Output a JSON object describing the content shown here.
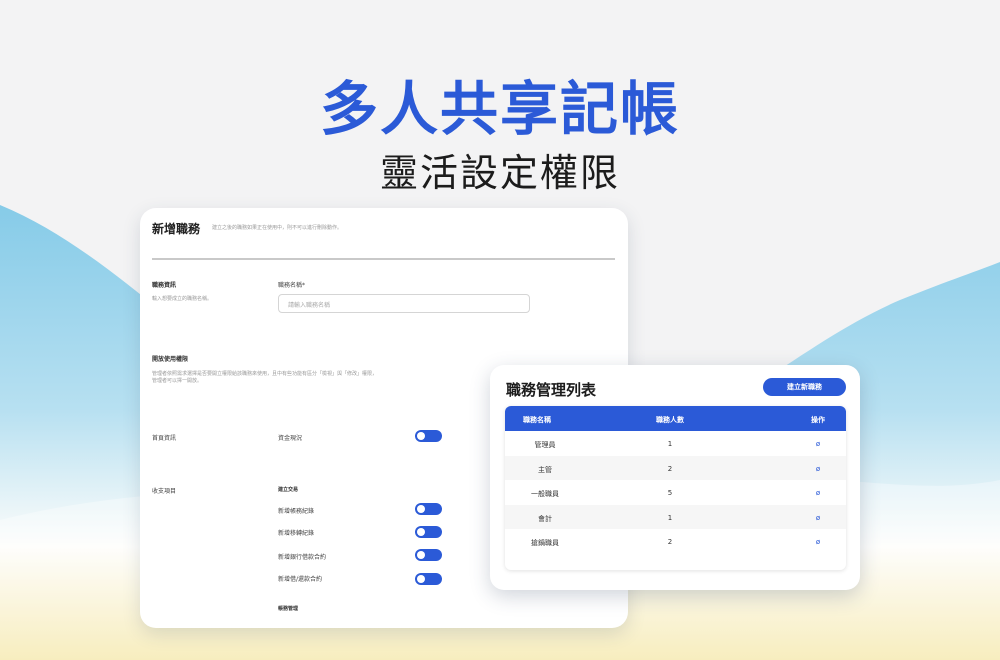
{
  "headline": "多人共享記帳",
  "subline": "靈活設定權限",
  "form": {
    "title": "新增職務",
    "title_hint": "建立之後的職務如果正在使用中，則不可以進行刪除動作。",
    "section_info": "職務資訊",
    "section_info_hint": "輸入想要成立的職務名稱。",
    "name_label": "職務名稱*",
    "name_placeholder": "請輸入職務名稱",
    "section_perm": "開放使用權限",
    "section_perm_hint_1": "管理者依照需求選擇是否要開立權限給該職務來使用，且中有些功能有區分「檢視」與「修改」權限，",
    "section_perm_hint_2": "管理者可以擇一開放。",
    "home_label": "首頁資訊",
    "home_item": "資金現況",
    "income_label": "收支項目",
    "create_group": "建立交易",
    "items": [
      "新增帳務紀錄",
      "新增移轉紀錄",
      "新增銀行借款合約",
      "新增借/還款合約"
    ],
    "manage_group": "帳務管理"
  },
  "list": {
    "title": "職務管理列表",
    "create_button": "建立新職務",
    "columns": [
      "職務名稱",
      "職務人數",
      "操作"
    ],
    "rows": [
      {
        "name": "管理員",
        "count": "1"
      },
      {
        "name": "主管",
        "count": "2"
      },
      {
        "name": "一般職員",
        "count": "5"
      },
      {
        "name": "會計",
        "count": "1"
      },
      {
        "name": "搶鍋職員",
        "count": "2"
      }
    ]
  },
  "icons": {
    "edit": "edit-icon",
    "toggle": "toggle-on"
  },
  "colors": {
    "accent": "#2b5ad7",
    "wave": "#7cc6e6",
    "sand": "#f3e6a6"
  }
}
